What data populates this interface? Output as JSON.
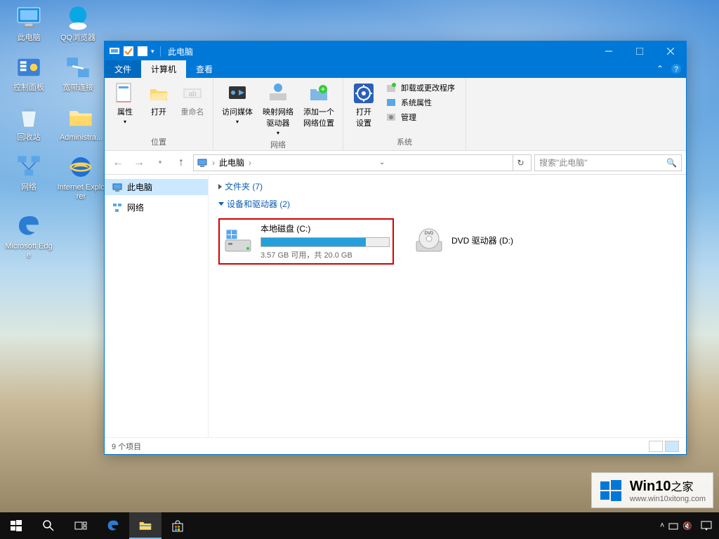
{
  "desktop_icons": {
    "this_pc": "此电脑",
    "qq_browser": "QQ浏览器",
    "control_panel": "控制面板",
    "broadband": "宽带连接",
    "recycle": "回收站",
    "admin": "Administra...",
    "network": "网络",
    "ie": "Internet Explorer",
    "edge": "Microsoft Edge"
  },
  "window": {
    "title": "此电脑",
    "tabs": {
      "file": "文件",
      "computer": "计算机",
      "view": "查看"
    },
    "ribbon": {
      "location": {
        "properties": "属性",
        "open": "打开",
        "rename": "重命名",
        "group": "位置"
      },
      "network": {
        "media": "访问媒体",
        "map": "映射网络\n驱动器",
        "addloc": "添加一个\n网络位置",
        "group": "网络"
      },
      "system": {
        "settings": "打开\n设置",
        "uninstall": "卸载或更改程序",
        "sysprops": "系统属性",
        "manage": "管理",
        "group": "系统"
      }
    },
    "breadcrumb": "此电脑",
    "search_placeholder": "搜索\"此电脑\"",
    "tree": {
      "this_pc": "此电脑",
      "network": "网络"
    },
    "groups": {
      "folders": "文件夹 (7)",
      "devices": "设备和驱动器 (2)"
    },
    "drive_c": {
      "name": "本地磁盘 (C:)",
      "free": "3.57 GB 可用，共 20.0 GB",
      "fill_pct": 82
    },
    "drive_d": {
      "name": "DVD 驱动器 (D:)"
    },
    "status": "9 个项目"
  },
  "watermark": {
    "brand": "Win10",
    "suffix": "之家",
    "url": "www.win10xitong.com"
  }
}
